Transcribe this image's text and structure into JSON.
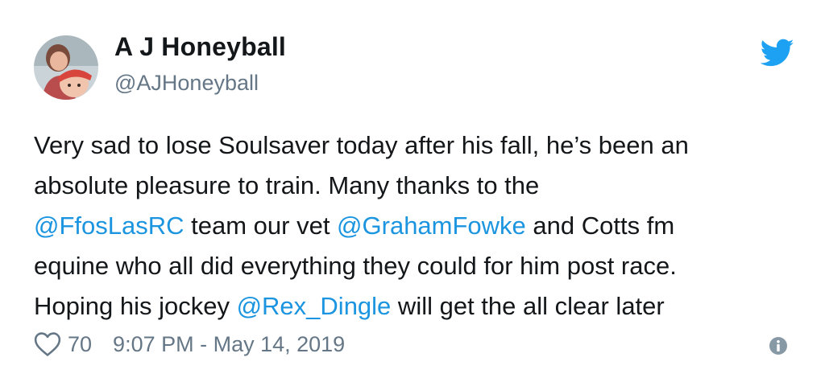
{
  "author": {
    "display_name": "A J Honeyball",
    "handle": "@AJHoneyball",
    "avatar_icon": "avatar-photo"
  },
  "tweet": {
    "lines": [
      [
        {
          "text": "Very sad to lose Soulsaver today after his fall, he’s been an",
          "mention": false
        }
      ],
      [
        {
          "text": "absolute pleasure to train. Many thanks to the",
          "mention": false
        }
      ],
      [
        {
          "text": "@FfosLasRC",
          "mention": true
        },
        {
          "text": " team our vet ",
          "mention": false
        },
        {
          "text": "@GrahamFowke",
          "mention": true
        },
        {
          "text": " and Cotts fm",
          "mention": false
        }
      ],
      [
        {
          "text": "equine who all did everything they could for him post race.",
          "mention": false
        }
      ],
      [
        {
          "text": "Hoping his jockey ",
          "mention": false
        },
        {
          "text": "@Rex_Dingle",
          "mention": true
        },
        {
          "text": " will get the all clear later",
          "mention": false
        }
      ]
    ]
  },
  "footer": {
    "like_count": "70",
    "timestamp": "9:07 PM - May 14, 2019"
  },
  "icons": {
    "brand": "twitter-bird-icon",
    "like": "heart-icon",
    "info": "info-icon"
  },
  "colors": {
    "brand_blue": "#1da1f2",
    "mention_blue": "#1b95e0",
    "text": "#14171a",
    "muted": "#657786"
  }
}
